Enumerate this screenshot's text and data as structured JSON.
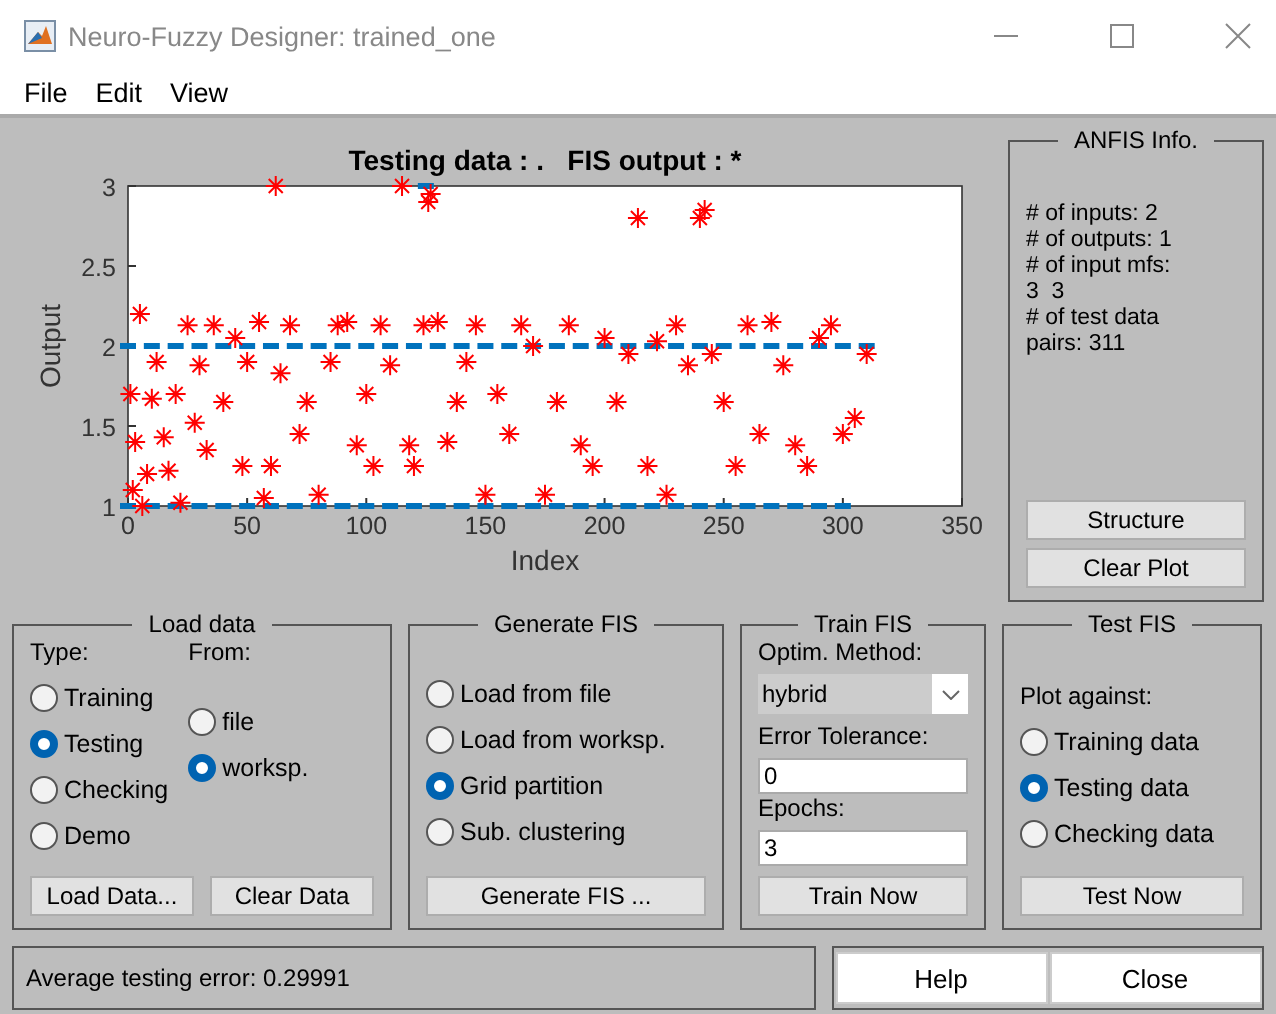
{
  "window": {
    "title": "Neuro-Fuzzy Designer: trained_one"
  },
  "menu": [
    "File",
    "Edit",
    "View"
  ],
  "plot": {
    "chart_data": {
      "type": "scatter",
      "title": "Testing data : .   FIS output : *",
      "xlabel": "Index",
      "ylabel": "Output",
      "xlim": [
        0,
        350
      ],
      "ylim": [
        1,
        3
      ],
      "xticks": [
        0,
        50,
        100,
        150,
        200,
        250,
        300,
        350
      ],
      "yticks": [
        1,
        1.5,
        2,
        2.5,
        3
      ],
      "series": [
        {
          "color": "#0072bd",
          "x": [
            0,
            10,
            20,
            30,
            40,
            50,
            60,
            70,
            80,
            90,
            100,
            110,
            120,
            130,
            140,
            150,
            160,
            170,
            180,
            190,
            200,
            210,
            220,
            230,
            240,
            250,
            260,
            270,
            280,
            290,
            300,
            310,
            0,
            10,
            20,
            30,
            40,
            50,
            60,
            70,
            80,
            90,
            100,
            110,
            120,
            130,
            140,
            150,
            160,
            170,
            180,
            190,
            200,
            210,
            220,
            230,
            240,
            250,
            260,
            270,
            280,
            290,
            300,
            125
          ],
          "values": [
            2,
            2,
            2,
            2,
            2,
            2,
            2,
            2,
            2,
            2,
            2,
            2,
            2,
            2,
            2,
            2,
            2,
            2,
            2,
            2,
            2,
            2,
            2,
            2,
            2,
            2,
            2,
            2,
            2,
            2,
            2,
            2,
            1,
            1,
            1,
            1,
            1,
            1,
            1,
            1,
            1,
            1,
            1,
            1,
            1,
            1,
            1,
            1,
            1,
            1,
            1,
            1,
            1,
            1,
            1,
            1,
            1,
            1,
            1,
            1,
            1,
            1,
            1,
            3
          ]
        },
        {
          "color": "#ff0000",
          "x": [
            1,
            2,
            3,
            5,
            6,
            8,
            10,
            12,
            15,
            17,
            20,
            22,
            25,
            28,
            30,
            33,
            36,
            40,
            45,
            48,
            50,
            55,
            57,
            60,
            62,
            64,
            68,
            72,
            75,
            80,
            85,
            88,
            92,
            96,
            100,
            103,
            106,
            110,
            115,
            118,
            120,
            124,
            126,
            127,
            130,
            134,
            138,
            142,
            146,
            150,
            155,
            160,
            165,
            170,
            175,
            180,
            185,
            190,
            195,
            200,
            205,
            210,
            214,
            218,
            222,
            226,
            230,
            235,
            240,
            242,
            245,
            250,
            255,
            260,
            265,
            270,
            275,
            280,
            285,
            290,
            295,
            300,
            305,
            310
          ],
          "values": [
            1.7,
            1.1,
            1.4,
            2.2,
            1,
            1.2,
            1.67,
            1.9,
            1.43,
            1.22,
            1.7,
            1.02,
            2.13,
            1.52,
            1.88,
            1.35,
            2.13,
            1.65,
            2.05,
            1.25,
            1.9,
            2.15,
            1.05,
            1.25,
            3,
            1.83,
            2.13,
            1.45,
            1.65,
            1.07,
            1.9,
            2.13,
            2.15,
            1.38,
            1.7,
            1.25,
            2.13,
            1.88,
            3,
            1.38,
            1.25,
            2.13,
            2.9,
            2.95,
            2.15,
            1.4,
            1.65,
            1.9,
            2.13,
            1.07,
            1.7,
            1.45,
            2.13,
            2,
            1.07,
            1.65,
            2.13,
            1.38,
            1.25,
            2.05,
            1.65,
            1.95,
            2.8,
            1.25,
            2.03,
            1.07,
            2.13,
            1.88,
            2.8,
            2.85,
            1.95,
            1.65,
            1.25,
            2.13,
            1.45,
            2.15,
            1.88,
            1.38,
            1.25,
            2.05,
            2.13,
            1.45,
            1.55,
            1.95
          ]
        }
      ]
    }
  },
  "anfis_info": {
    "title": "ANFIS Info.",
    "lines": [
      "# of inputs: 2",
      "# of outputs: 1",
      "# of input mfs:",
      "3  3",
      "# of test data",
      "pairs: 311"
    ],
    "buttons": [
      "Structure",
      "Clear Plot"
    ]
  },
  "load_data": {
    "title": "Load data",
    "type_label": "Type:",
    "from_label": "From:",
    "types": [
      {
        "label": "Training",
        "selected": false
      },
      {
        "label": "Testing",
        "selected": true
      },
      {
        "label": "Checking",
        "selected": false
      },
      {
        "label": "Demo",
        "selected": false
      }
    ],
    "sources": [
      {
        "label": "file",
        "selected": false
      },
      {
        "label": "worksp.",
        "selected": true
      }
    ],
    "buttons": [
      "Load Data...",
      "Clear Data"
    ]
  },
  "generate_fis": {
    "title": "Generate FIS",
    "options": [
      {
        "label": "Load from file",
        "selected": false
      },
      {
        "label": "Load from worksp.",
        "selected": false
      },
      {
        "label": "Grid partition",
        "selected": true
      },
      {
        "label": "Sub. clustering",
        "selected": false
      }
    ],
    "button": "Generate FIS ..."
  },
  "train_fis": {
    "title": "Train FIS",
    "method_label": "Optim. Method:",
    "method": "hybrid",
    "tolerance_label": "Error Tolerance:",
    "tolerance": "0",
    "epochs_label": "Epochs:",
    "epochs": "3",
    "button": "Train Now"
  },
  "test_fis": {
    "title": "Test FIS",
    "plot_label": "Plot against:",
    "options": [
      {
        "label": "Training data",
        "selected": false
      },
      {
        "label": "Testing data",
        "selected": true
      },
      {
        "label": "Checking data",
        "selected": false
      }
    ],
    "button": "Test Now"
  },
  "status": "Average testing error: 0.29991",
  "buttons": [
    "Help",
    "Close"
  ]
}
